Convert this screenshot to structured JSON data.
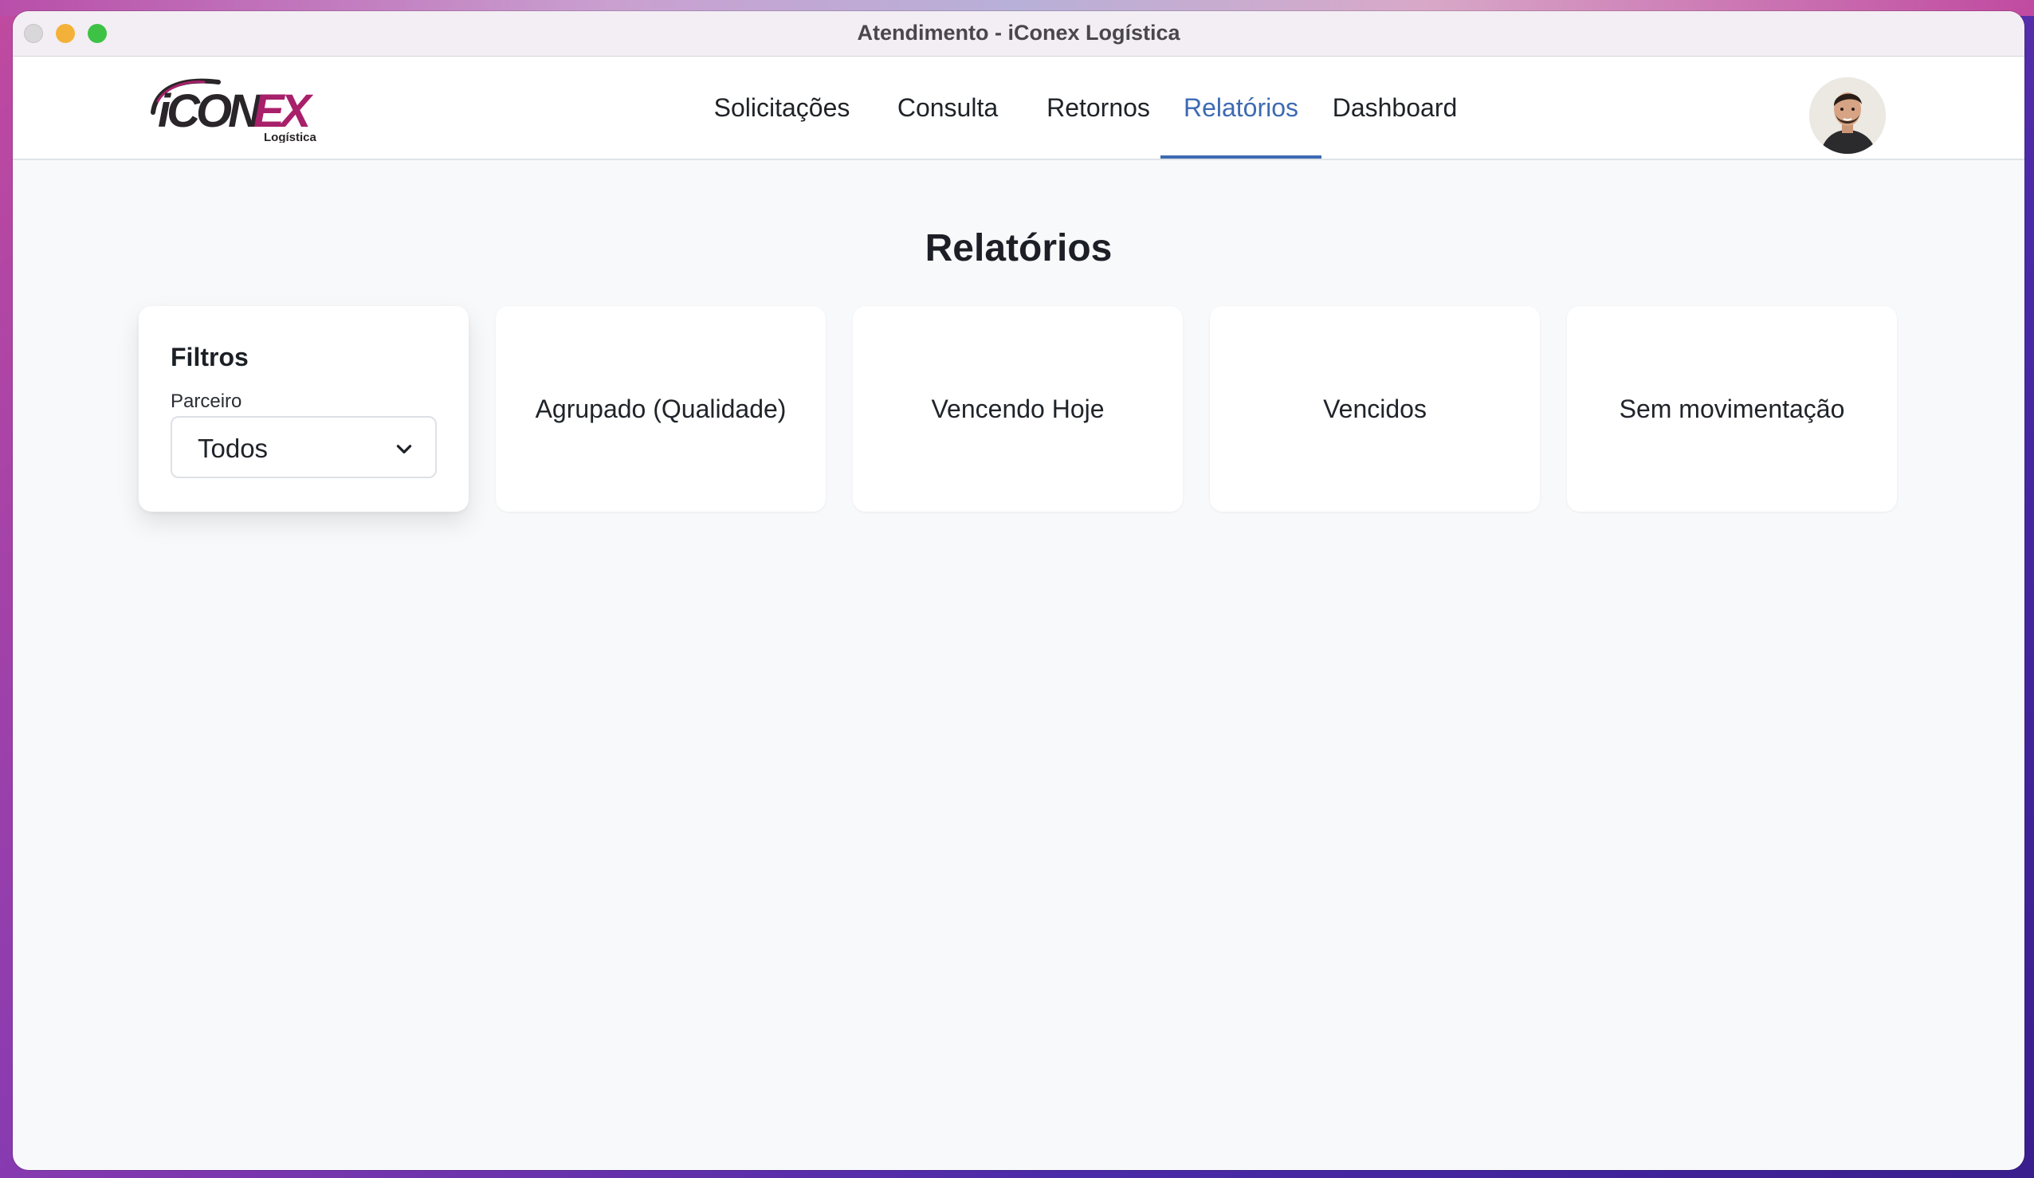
{
  "window": {
    "title": "Atendimento - iConex Logística"
  },
  "logo": {
    "wordmark": "iCONEX",
    "subtitle": "Logística"
  },
  "nav": {
    "items": [
      {
        "label": "Solicitações"
      },
      {
        "label": "Consulta"
      },
      {
        "label": "Retornos"
      },
      {
        "label": "Relatórios",
        "active": true
      },
      {
        "label": "Dashboard"
      }
    ]
  },
  "page": {
    "title": "Relatórios"
  },
  "filters": {
    "title": "Filtros",
    "partner_label": "Parceiro",
    "partner_value": "Todos"
  },
  "reports": [
    {
      "label": "Agrupado (Qualidade)"
    },
    {
      "label": "Vencendo Hoje"
    },
    {
      "label": "Vencidos"
    },
    {
      "label": "Sem movimentação"
    }
  ],
  "colors": {
    "accent": "#3d6ab3",
    "logo_dark": "#2a2528",
    "logo_magenta": "#a8206a"
  },
  "icons": {
    "select_chevron": "chevron-down-icon",
    "avatar": "user-avatar"
  }
}
